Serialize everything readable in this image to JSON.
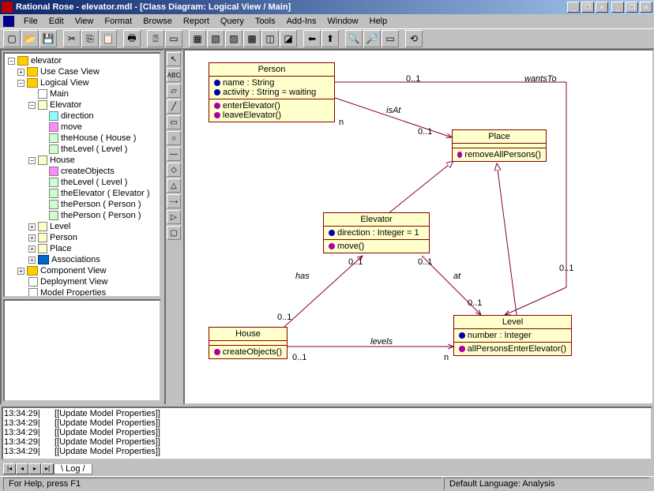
{
  "title": "Rational Rose - elevator.mdl - [Class Diagram: Logical View / Main]",
  "menu": [
    "File",
    "Edit",
    "View",
    "Format",
    "Browse",
    "Report",
    "Query",
    "Tools",
    "Add-Ins",
    "Window",
    "Help"
  ],
  "tree": {
    "root": "elevator",
    "ucv": "Use Case View",
    "lv": "Logical View",
    "main": "Main",
    "elev": "Elevator",
    "e_dir": "direction",
    "e_move": "move",
    "e_house": "theHouse ( House )",
    "e_level": "theLevel ( Level )",
    "house": "House",
    "h_co": "createObjects",
    "h_lvl": "theLevel ( Level )",
    "h_el": "theElevator ( Elevator )",
    "h_p1": "thePerson ( Person )",
    "h_p2": "thePerson ( Person )",
    "level": "Level",
    "person": "Person",
    "place": "Place",
    "assoc": "Associations",
    "cv": "Component View",
    "dv": "Deployment View",
    "mp": "Model Properties"
  },
  "uml": {
    "person": {
      "name": "Person",
      "a1": "name : String",
      "a2": "activity : String = waiting",
      "o1": "enterElevator()",
      "o2": "leaveElevator()"
    },
    "place": {
      "name": "Place",
      "o1": "removeAllPersons()"
    },
    "elev": {
      "name": "Elevator",
      "a1": "direction : Integer = 1",
      "o1": "move()"
    },
    "house": {
      "name": "House",
      "o1": "createObjects()"
    },
    "level": {
      "name": "Level",
      "a1": "number : Integer",
      "o1": "allPersonsEnterElevator()"
    }
  },
  "rel": {
    "isAt": "isAt",
    "wantsTo": "wantsTo",
    "has": "has",
    "at": "at",
    "levels": "levels",
    "m01": "0..1",
    "mn": "n"
  },
  "log": {
    "t": "13:34:29|",
    "m": "[[Update Model Properties]]"
  },
  "logtab": "Log",
  "status": {
    "help": "For Help, press F1",
    "lang": "Default Language: Analysis"
  }
}
